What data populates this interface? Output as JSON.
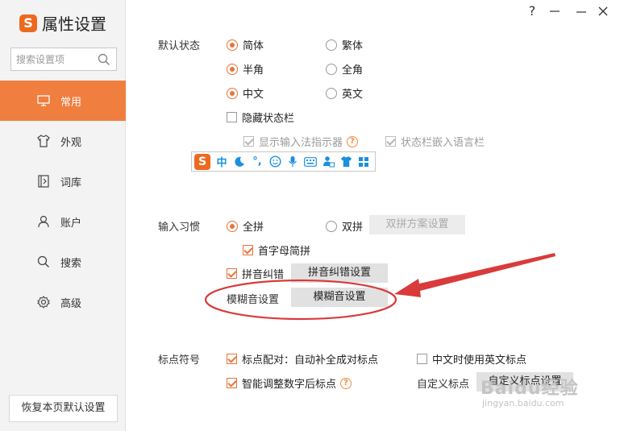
{
  "app": {
    "logo": "S",
    "title": "属性设置"
  },
  "search": {
    "placeholder": "搜索设置项"
  },
  "window_controls": {
    "help": "?",
    "minimize": "—",
    "close": "✕"
  },
  "sidebar": {
    "items": [
      {
        "label": "常用",
        "icon": "monitor-icon",
        "active": true
      },
      {
        "label": "外观",
        "icon": "shirt-icon",
        "active": false
      },
      {
        "label": "词库",
        "icon": "book-icon",
        "active": false
      },
      {
        "label": "账户",
        "icon": "user-icon",
        "active": false
      },
      {
        "label": "搜索",
        "icon": "search-icon",
        "active": false
      },
      {
        "label": "高级",
        "icon": "gear-icon",
        "active": false
      }
    ],
    "reset_label": "恢复本页默认设置"
  },
  "default_state": {
    "label": "默认状态",
    "simplified": "简体",
    "traditional": "繁体",
    "half_width": "半角",
    "full_width": "全角",
    "chinese": "中文",
    "english": "英文",
    "hide_status_bar": "隐藏状态栏",
    "show_indicator": "显示输入法指示器",
    "embed_lang_bar": "状态栏嵌入语言栏",
    "toolbar": {
      "logo": "S",
      "items": [
        "中",
        "☽",
        "°,",
        "☺",
        "🎤",
        "⌨",
        "♟",
        "👕",
        "▦"
      ]
    }
  },
  "input_habit": {
    "label": "输入习惯",
    "full_pinyin": "全拼",
    "double_pinyin": "双拼",
    "double_scheme_btn": "双拼方案设置",
    "initial_abbrev": "首字母简拼",
    "pinyin_correction": "拼音纠错",
    "pinyin_correction_btn": "拼音纠错设置",
    "fuzzy_label": "模糊音设置",
    "fuzzy_btn": "模糊音设置"
  },
  "punctuation": {
    "label": "标点符号",
    "pair_complete": "标点配对：自动补全成对标点",
    "english_in_chinese": "中文时使用英文标点",
    "smart_after_digit": "智能调整数字后标点",
    "custom_label": "自定义标点",
    "custom_btn": "自定义标点设置"
  },
  "annotation_color": "#d93b3b",
  "accent_color": "#f07e3f",
  "watermark": {
    "line1": "Baidu经验",
    "line2": "jingyan.baidu.com"
  }
}
